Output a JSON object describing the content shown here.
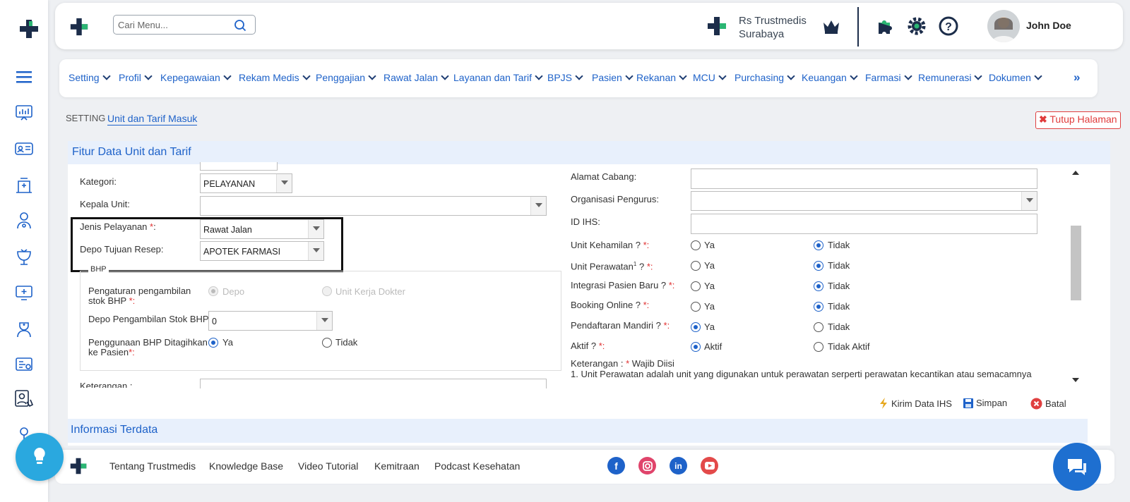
{
  "header": {
    "search_placeholder": "Cari Menu...",
    "hospital_line1": "Rs Trustmedis",
    "hospital_line2": "Surabaya",
    "user_name": "John Doe"
  },
  "menu": {
    "items": [
      "Setting",
      "Profil",
      "Kepegawaian",
      "Rekam Medis",
      "Penggajian",
      "Rawat Jalan",
      "Layanan dan Tarif",
      "BPJS",
      "Pasien",
      "Rekanan",
      "MCU",
      "Purchasing",
      "Keuangan",
      "Farmasi",
      "Remunerasi",
      "Dokumen"
    ],
    "more": "»"
  },
  "breadcrumb": {
    "root": "SETTING",
    "current": "Unit dan Tarif Masuk"
  },
  "close_page": "Tutup Halaman",
  "panel_title": "Fitur Data Unit dan Tarif",
  "left_form": {
    "kategori_label": "Kategori:",
    "kategori_value": "PELAYANAN",
    "kepala_label": "Kepala Unit:",
    "kepala_value": "",
    "jenis_label": "Jenis Pelayanan ",
    "jenis_value": "Rawat Jalan",
    "depo_label": "Depo Tujuan Resep:",
    "depo_value": "APOTEK FARMASI",
    "bhp_legend": "BHP",
    "pengaturan_label_1": "Pengaturan pengambilan",
    "pengaturan_label_2": "stok BHP ",
    "opt_depo": "Depo",
    "opt_unit_kerja": "Unit Kerja Dokter",
    "depo_stok_label": "Depo Pengambilan Stok BHP:",
    "depo_stok_value": "0",
    "penggunaan_label_1": "Penggunaan BHP Ditagihkan",
    "penggunaan_label_2": "ke Pasien",
    "opt_ya": "Ya",
    "opt_tidak": "Tidak",
    "keterangan_label": "Keterangan :",
    "req_mark": "*",
    "colon": ":",
    "colon_star": "*:"
  },
  "right_form": {
    "alamat_label": "Alamat Cabang:",
    "organisasi_label": "Organisasi Pengurus:",
    "idihs_label": "ID IHS:",
    "kehamilan_label": "Unit Kehamilan ? ",
    "perawatan_label": "Unit Perawatan",
    "perawatan_sup": "1",
    "perawatan_q": " ? ",
    "integrasi_label": "Integrasi Pasien Baru ? ",
    "booking_label": "Booking Online ? ",
    "pendaftaran_label": "Pendaftaran Mandiri ? ",
    "aktif_label": "Aktif ? ",
    "ya": "Ya",
    "tidak": "Tidak",
    "aktif": "Aktif",
    "tidak_aktif": "Tidak Aktif",
    "req_mark": "*:",
    "note_prefix": "Keterangan : ",
    "note_star": "*",
    "note_wajib": " Wajib Diisi",
    "note_1": "1. Unit Perawatan adalah unit yang digunakan untuk perawatan serperti perawatan kecantikan atau semacamnya"
  },
  "actions": {
    "kirim": "Kirim Data IHS",
    "simpan": "Simpan",
    "batal": "Batal"
  },
  "info_title": "Informasi Terdata",
  "footer": {
    "links": [
      "Tentang Trustmedis",
      "Knowledge Base",
      "Video Tutorial",
      "Kemitraan",
      "Podcast Kesehatan"
    ]
  },
  "colors": {
    "accent": "#1e62c9",
    "brand_green": "#2bb673",
    "brand_navy": "#1c2d4a",
    "required": "#e03030"
  }
}
